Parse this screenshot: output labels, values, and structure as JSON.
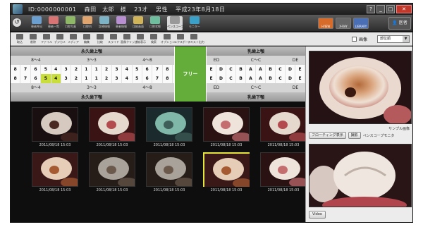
{
  "patient": {
    "id": "ID:0000000001",
    "name": "森田　太郎　様",
    "age": "23才",
    "sex": "男性",
    "date": "平成23年8月18日"
  },
  "window_buttons": [
    "?",
    "_",
    "□",
    "✕"
  ],
  "toolbar1": {
    "items": [
      {
        "label": "患者呼出",
        "icon": "patient-icon",
        "color": "#6a9fd0"
      },
      {
        "label": "患者一覧",
        "icon": "patient-list-icon",
        "color": "#d87474"
      },
      {
        "label": "口腔写真",
        "icon": "camera-icon",
        "color": "#8fb866"
      },
      {
        "label": "口腔内",
        "icon": "mouth-icon",
        "color": "#e0a46e"
      },
      {
        "label": "診療情報",
        "icon": "info-icon",
        "color": "#7db3c6"
      },
      {
        "label": "患者情報",
        "icon": "person-icon",
        "color": "#b88fd0"
      },
      {
        "label": "比較画面",
        "icon": "compare-icon",
        "color": "#d0b45a"
      },
      {
        "label": "口腔状態",
        "icon": "state-icon",
        "color": "#6fbf9f"
      },
      {
        "label": "ペンスコープ",
        "icon": "penscope-icon",
        "color": "#999999",
        "active": true
      },
      {
        "label": "モニター",
        "icon": "monitor-icon",
        "color": "#3aa0c8"
      }
    ],
    "modes": [
      {
        "label": "I-VIEW",
        "color": "#d66b2a"
      },
      {
        "label": "X-RAY",
        "color": "#666666"
      },
      {
        "label": "LIBRARY",
        "color": "#4a6fb5"
      }
    ],
    "user_label": "医者"
  },
  "toolbar2": {
    "items": [
      "取込",
      "削除",
      "ファイル",
      "デジカメ",
      "メディア",
      "編集",
      "比較",
      "スライド",
      "画像クリップ",
      "比較表示",
      "検索",
      "オプション",
      "エクスポート",
      "テキスト出力"
    ],
    "image_check_label": "画像",
    "select_value": "部位順"
  },
  "tooth_chart": {
    "upper_left_header": "永久歯上顎",
    "upper_right_header": "乳歯上顎",
    "lower_left_header": "永久歯下顎",
    "lower_right_header": "乳歯下顎",
    "left_sub": [
      "8～4",
      "3～3",
      "4～8"
    ],
    "right_sub": [
      "ED",
      "C～C",
      "DE"
    ],
    "upper_left_teeth": [
      "8",
      "7",
      "6",
      "5",
      "4",
      "3",
      "2",
      "1",
      "1",
      "2",
      "3",
      "4",
      "5",
      "6",
      "7",
      "8"
    ],
    "lower_left_teeth": [
      "8",
      "7",
      "6",
      "5",
      "4",
      "3",
      "2",
      "1",
      "1",
      "2",
      "3",
      "4",
      "5",
      "6",
      "7",
      "8"
    ],
    "upper_right_teeth": [
      "E",
      "D",
      "C",
      "B",
      "A",
      "A",
      "B",
      "C",
      "D",
      "E"
    ],
    "lower_right_teeth": [
      "E",
      "D",
      "C",
      "B",
      "A",
      "A",
      "B",
      "C",
      "D",
      "E"
    ],
    "highlighted_lower": [
      3,
      4
    ],
    "free_label": "フリー",
    "highlight_color": "#c9de3a"
  },
  "gallery": {
    "thumbnails": [
      {
        "date": "2011/08/18 15:03",
        "palette": "tooth-dark"
      },
      {
        "date": "2011/08/18 15:03",
        "palette": "tooth-red"
      },
      {
        "date": "2011/08/18 15:03",
        "palette": "tooth-blue"
      },
      {
        "date": "2011/08/18 15:03",
        "palette": "tooth-pink"
      },
      {
        "date": "2011/08/18 15:03",
        "palette": "tooth-red"
      },
      {
        "date": "2011/08/18 15:03",
        "palette": "tooth-cavity"
      },
      {
        "date": "2011/08/18 15:03",
        "palette": "tooth-metal"
      },
      {
        "date": "2011/08/18 15:03",
        "palette": "tooth-metal"
      },
      {
        "date": "2011/08/18 15:03",
        "palette": "tooth-cavity",
        "selected": true
      },
      {
        "date": "2011/08/18 15:03",
        "palette": "tooth-pink"
      }
    ]
  },
  "right_panel": {
    "sample_label": "サンプル画像",
    "floating_button": "フローティング表示",
    "capture_button": "撮影",
    "monitor_label": "ペンスコープモニタ",
    "video_button": "Video"
  }
}
